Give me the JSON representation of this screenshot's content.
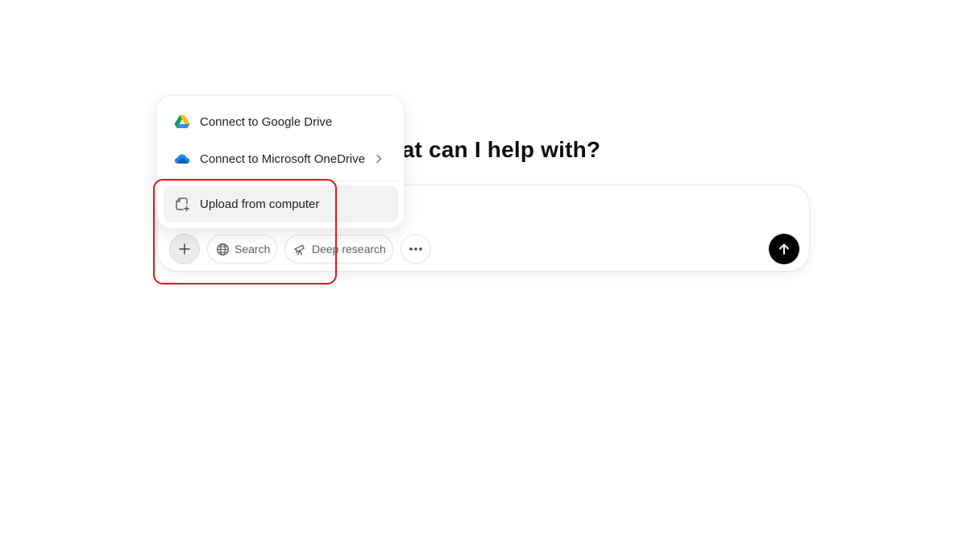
{
  "main": {
    "heading": "What can I help with?"
  },
  "composer": {
    "input_value": "",
    "input_placeholder": "",
    "tools": {
      "plus_icon": "plus-icon",
      "search_label": "Search",
      "search_icon": "globe-icon",
      "deep_research_label": "Deep research",
      "deep_research_icon": "telescope-icon",
      "more_icon": "ellipsis-icon"
    },
    "send_icon": "arrow-up-icon"
  },
  "attach_menu": {
    "items": [
      {
        "label": "Connect to Google Drive",
        "icon": "google-drive-icon"
      },
      {
        "label": "Connect to Microsoft OneDrive",
        "icon": "onedrive-icon",
        "has_submenu": true
      },
      {
        "label": "Upload from computer",
        "icon": "upload-file-icon",
        "highlighted": true
      }
    ]
  },
  "colors": {
    "highlight_outline": "#e0161b",
    "send_button": "#000000",
    "hover_row": "#f2f2f2"
  }
}
